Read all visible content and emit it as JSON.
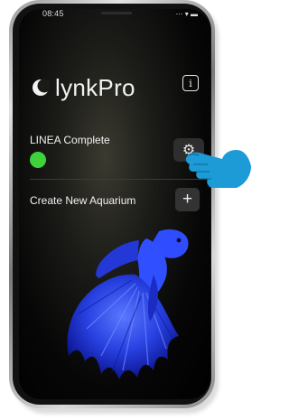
{
  "status_bar": {
    "time": "08:45",
    "icons": "⋯ ▾ ▬"
  },
  "app": {
    "logo_text": "lynkPro"
  },
  "device": {
    "name": "LINEA Complete",
    "status_color": "#3ed33a"
  },
  "actions": {
    "create_label": "Create New Aquarium",
    "add_symbol": "+",
    "info_symbol": "i",
    "settings_symbol": "⚙"
  },
  "colors": {
    "accent_green": "#3ed33a",
    "fish_blue": "#2b4bff",
    "cursor_blue": "#1c9bd6"
  },
  "icons": [
    "info-icon",
    "gear-icon",
    "plus-icon",
    "hand-pointer-icon",
    "logo-icon"
  ]
}
